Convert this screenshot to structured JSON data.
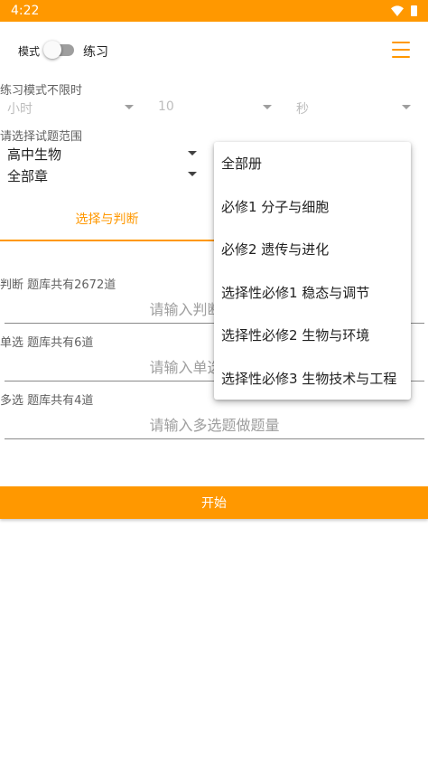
{
  "status": {
    "time": "4:22"
  },
  "toolbar": {
    "mode_label": "模式",
    "practice_label": "练习"
  },
  "time_limit": {
    "label": "练习模式不限时",
    "hours_placeholder": "小时",
    "minutes_value": "10",
    "seconds_placeholder": "秒"
  },
  "scope": {
    "label": "请选择试题范围",
    "subject": "高中生物",
    "chapter": "全部章"
  },
  "tabs": [
    {
      "label": "选择与判断"
    }
  ],
  "questions": {
    "judge": {
      "label": "判断 题库共有2672道",
      "placeholder": "请输入判断题做题量"
    },
    "single": {
      "label": "单选 题库共有6道",
      "placeholder": "请输入单选题做题量"
    },
    "multi": {
      "label": "多选 题库共有4道",
      "placeholder": "请输入多选题做题量"
    }
  },
  "start_button": "开始",
  "dropdown": {
    "items": [
      "全部册",
      "必修1 分子与细胞",
      "必修2 遗传与进化",
      "选择性必修1 稳态与调节",
      "选择性必修2 生物与环境",
      "选择性必修3 生物技术与工程"
    ]
  },
  "colors": {
    "accent": "#FF9800",
    "hint": "#9e9e9e"
  }
}
